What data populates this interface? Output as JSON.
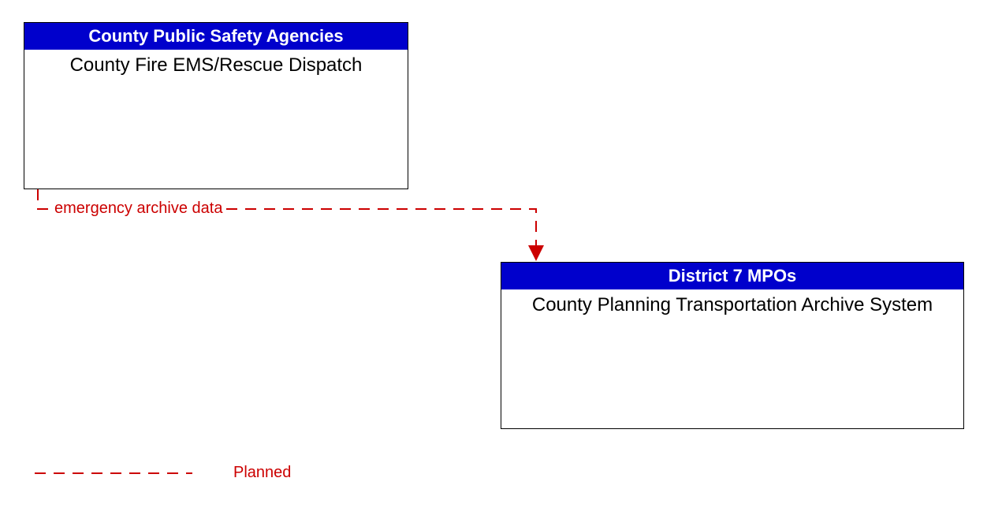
{
  "entities": {
    "source": {
      "header": "County Public Safety Agencies",
      "body": "County Fire EMS/Rescue Dispatch"
    },
    "target": {
      "header": "District 7 MPOs",
      "body": "County Planning Transportation Archive System"
    }
  },
  "flow": {
    "label": "emergency archive data"
  },
  "legend": {
    "planned": "Planned"
  },
  "colors": {
    "headerBg": "#0000CC",
    "flowLine": "#CC0000"
  }
}
